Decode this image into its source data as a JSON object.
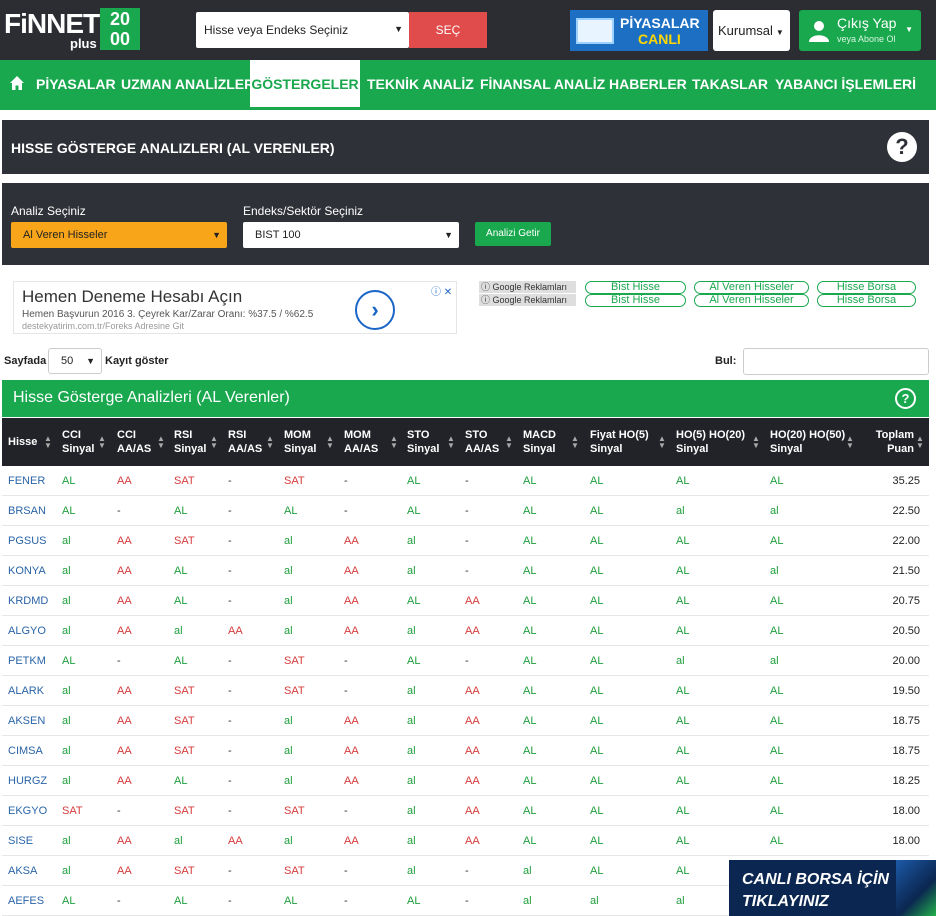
{
  "header": {
    "logo_text": "FiNNET",
    "logo_plus": "plus",
    "logo_badge_top": "20",
    "logo_badge_bottom": "00",
    "search_placeholder": "Hisse veya Endeks Seçiniz",
    "search_button": "SEÇ",
    "canli_line1": "PİYASALAR",
    "canli_line2": "CANLI",
    "kurumsal": "Kurumsal",
    "logout": "Çıkış Yap",
    "logout_sub": "veya Abone Ol"
  },
  "nav": {
    "items": [
      "PİYASALAR",
      "UZMAN ANALİZLER",
      "GÖSTERGELER",
      "TEKNİK ANALİZ",
      "FİNANSAL ANALİZ",
      "HABERLER",
      "TAKASLAR",
      "YABANCI İŞLEMLERİ"
    ],
    "active": "GÖSTERGELER"
  },
  "page": {
    "title": "HISSE GÖSTERGE ANALIZLERI (AL VERENLER)",
    "help": "?"
  },
  "filters": {
    "analysis_label": "Analiz Seçiniz",
    "analysis_value": "Al Veren Hisseler",
    "index_label": "Endeks/Sektör Seçiniz",
    "index_value": "BIST 100",
    "submit": "Analizi Getir"
  },
  "ad": {
    "headline": "Hemen Deneme Hesabı Açın",
    "line1": "Hemen Başvurun 2016 3. Çeyrek Kar/Zarar Oranı: %37.5 / %62.5",
    "line2": "destekyatirim.com.tr/Foreks Adresine Git",
    "google_label": "Google Reklamları",
    "chips": [
      "Bist Hisse",
      "Al Veren Hisseler",
      "Hisse Borsa"
    ]
  },
  "controls": {
    "sayfada": "Sayfada",
    "page_size": "50",
    "kayit": "Kayıt göster",
    "bul": "Bul:"
  },
  "table": {
    "title": "Hisse Gösterge Analizleri (AL Verenler)",
    "headers": [
      [
        "Hisse",
        ""
      ],
      [
        "CCI",
        "Sinyal"
      ],
      [
        "CCI",
        "AA/AS"
      ],
      [
        "RSI",
        "Sinyal"
      ],
      [
        "RSI",
        "AA/AS"
      ],
      [
        "MOM",
        "Sinyal"
      ],
      [
        "MOM",
        "AA/AS"
      ],
      [
        "STO",
        "Sinyal"
      ],
      [
        "STO",
        "AA/AS"
      ],
      [
        "MACD",
        "Sinyal"
      ],
      [
        "Fiyat HO(5)",
        "Sinyal"
      ],
      [
        "HO(5) HO(20)",
        "Sinyal"
      ],
      [
        "HO(20) HO(50)",
        "Sinyal"
      ],
      [
        "Toplam",
        "Puan"
      ]
    ],
    "rows": [
      [
        "FENER",
        "AL",
        "AA",
        "SAT",
        "-",
        "SAT",
        "-",
        "AL",
        "-",
        "AL",
        "AL",
        "AL",
        "AL",
        "35.25"
      ],
      [
        "BRSAN",
        "AL",
        "-",
        "AL",
        "-",
        "AL",
        "-",
        "AL",
        "-",
        "AL",
        "AL",
        "al",
        "al",
        "22.50"
      ],
      [
        "PGSUS",
        "al",
        "AA",
        "SAT",
        "-",
        "al",
        "AA",
        "al",
        "-",
        "AL",
        "AL",
        "AL",
        "AL",
        "22.00"
      ],
      [
        "KONYA",
        "al",
        "AA",
        "AL",
        "-",
        "al",
        "AA",
        "al",
        "-",
        "AL",
        "AL",
        "AL",
        "al",
        "21.50"
      ],
      [
        "KRDMD",
        "al",
        "AA",
        "AL",
        "-",
        "al",
        "AA",
        "AL",
        "AA",
        "AL",
        "AL",
        "AL",
        "AL",
        "20.75"
      ],
      [
        "ALGYO",
        "al",
        "AA",
        "al",
        "AA",
        "al",
        "AA",
        "al",
        "AA",
        "AL",
        "AL",
        "AL",
        "AL",
        "20.50"
      ],
      [
        "PETKM",
        "AL",
        "-",
        "AL",
        "-",
        "SAT",
        "-",
        "AL",
        "-",
        "AL",
        "AL",
        "al",
        "al",
        "20.00"
      ],
      [
        "ALARK",
        "al",
        "AA",
        "SAT",
        "-",
        "SAT",
        "-",
        "al",
        "AA",
        "AL",
        "AL",
        "AL",
        "AL",
        "19.50"
      ],
      [
        "AKSEN",
        "al",
        "AA",
        "SAT",
        "-",
        "al",
        "AA",
        "al",
        "AA",
        "AL",
        "AL",
        "AL",
        "AL",
        "18.75"
      ],
      [
        "CIMSA",
        "al",
        "AA",
        "SAT",
        "-",
        "al",
        "AA",
        "al",
        "AA",
        "AL",
        "AL",
        "AL",
        "AL",
        "18.75"
      ],
      [
        "HURGZ",
        "al",
        "AA",
        "AL",
        "-",
        "al",
        "AA",
        "al",
        "AA",
        "AL",
        "AL",
        "AL",
        "AL",
        "18.25"
      ],
      [
        "EKGYO",
        "SAT",
        "-",
        "SAT",
        "-",
        "SAT",
        "-",
        "al",
        "AA",
        "AL",
        "AL",
        "AL",
        "AL",
        "18.00"
      ],
      [
        "SISE",
        "al",
        "AA",
        "al",
        "AA",
        "al",
        "AA",
        "al",
        "AA",
        "AL",
        "AL",
        "AL",
        "AL",
        "18.00"
      ],
      [
        "AKSA",
        "al",
        "AA",
        "SAT",
        "-",
        "SAT",
        "-",
        "al",
        "-",
        "al",
        "AL",
        "AL",
        "",
        ""
      ],
      [
        "AEFES",
        "AL",
        "-",
        "AL",
        "-",
        "AL",
        "-",
        "AL",
        "-",
        "al",
        "al",
        "al",
        "",
        ""
      ]
    ]
  },
  "banner": {
    "line1": "CANLI BORSA İÇİN",
    "line2": "TIKLAYINIZ"
  }
}
